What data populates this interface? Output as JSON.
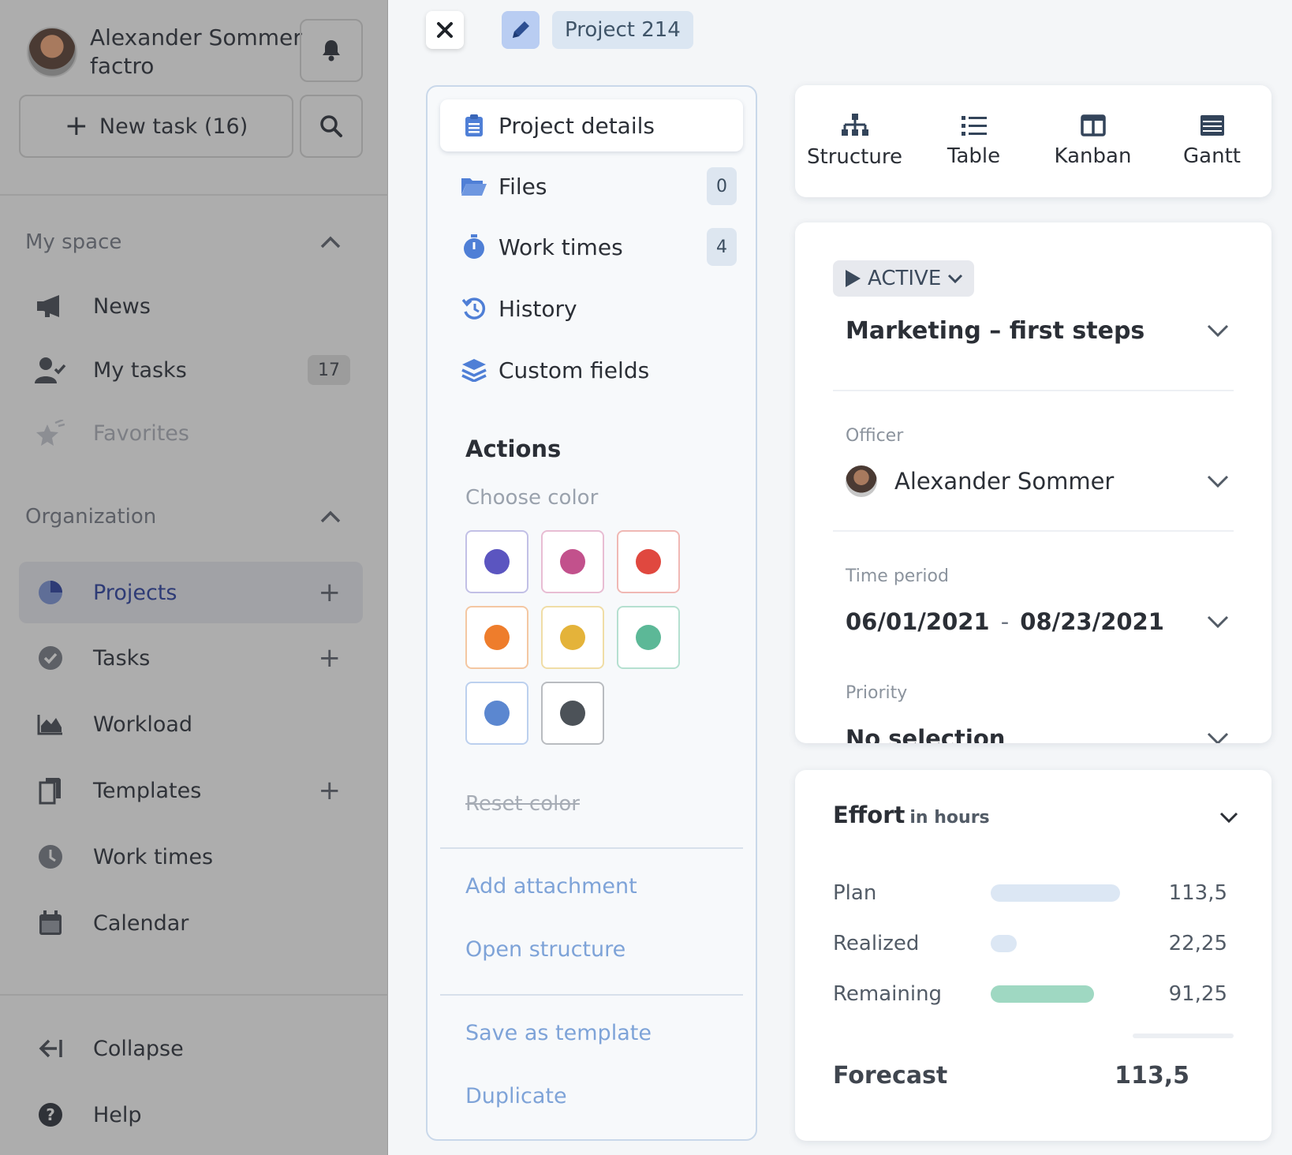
{
  "sidebar": {
    "user_name": "Alexander Sommer",
    "org_name": "factro",
    "new_task_label": "New task (16)",
    "my_space": {
      "title": "My space",
      "items": [
        {
          "label": "News"
        },
        {
          "label": "My tasks",
          "count": "17"
        },
        {
          "label": "Favorites"
        }
      ]
    },
    "organization": {
      "title": "Organization",
      "items": [
        {
          "label": "Projects"
        },
        {
          "label": "Tasks"
        },
        {
          "label": "Workload"
        },
        {
          "label": "Templates"
        },
        {
          "label": "Work times"
        },
        {
          "label": "Calendar"
        }
      ]
    },
    "footer": [
      {
        "label": "Collapse"
      },
      {
        "label": "Help"
      }
    ]
  },
  "topbar": {
    "project_label": "Project 214"
  },
  "panel": {
    "tabs": [
      {
        "label": "Project details"
      },
      {
        "label": "Files",
        "count": "0"
      },
      {
        "label": "Work times",
        "count": "4"
      },
      {
        "label": "History"
      },
      {
        "label": "Custom fields"
      }
    ],
    "actions_title": "Actions",
    "choose_color_label": "Choose color",
    "colors": [
      {
        "dot": "#5b55c0",
        "border": "#c2c0e6"
      },
      {
        "dot": "#c2518c",
        "border": "#e8bdd3"
      },
      {
        "dot": "#e0483f",
        "border": "#f0b8b4"
      },
      {
        "dot": "#ee7d2c",
        "border": "#f4c7a2"
      },
      {
        "dot": "#e4b33a",
        "border": "#f0dda6"
      },
      {
        "dot": "#5cb897",
        "border": "#b5e0d0"
      },
      {
        "dot": "#5b87d0",
        "border": "#bcd0ee"
      },
      {
        "dot": "#4c5258",
        "border": "#b9bcc0"
      }
    ],
    "reset_color_label": "Reset color",
    "links": [
      "Add attachment",
      "Open structure",
      "Save as template",
      "Duplicate"
    ]
  },
  "views": [
    {
      "label": "Structure",
      "icon": "structure-icon"
    },
    {
      "label": "Table",
      "icon": "list-icon"
    },
    {
      "label": "Kanban",
      "icon": "kanban-icon"
    },
    {
      "label": "Gantt",
      "icon": "gantt-icon"
    }
  ],
  "details": {
    "status": "ACTIVE",
    "project_title": "Marketing – first steps",
    "officer_label": "Officer",
    "officer_name": "Alexander Sommer",
    "time_period_label": "Time period",
    "start_date": "06/01/2021",
    "date_separator": "-",
    "end_date": "08/23/2021",
    "priority_label": "Priority",
    "priority_value": "No selection"
  },
  "effort": {
    "title": "Effort",
    "unit": "in hours",
    "rows": [
      {
        "label": "Plan",
        "value": "113,5",
        "fraction": 1.0,
        "color": "#dce7f4"
      },
      {
        "label": "Realized",
        "value": "22,25",
        "fraction": 0.2,
        "color": "#dce7f4"
      },
      {
        "label": "Remaining",
        "value": "91,25",
        "fraction": 0.8,
        "color": "#9fd8c2"
      }
    ],
    "forecast_label": "Forecast",
    "forecast_value": "113,5"
  }
}
